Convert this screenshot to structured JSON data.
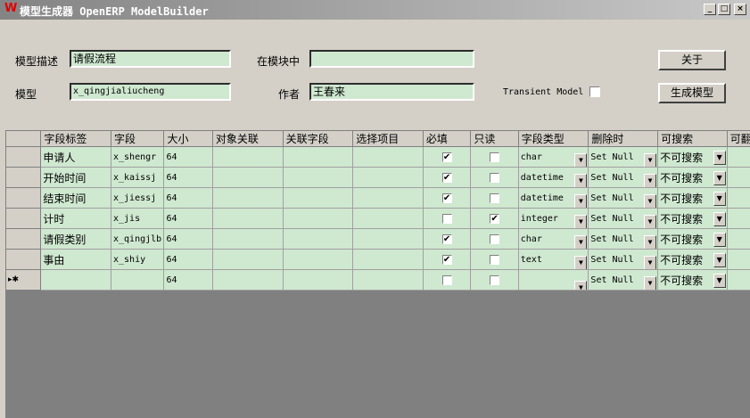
{
  "window": {
    "title": "模型生成器 OpenERP ModelBuilder",
    "minimize": "_",
    "maximize": "□",
    "close": "×"
  },
  "form": {
    "desc_label": "模型描述",
    "desc_value": "请假流程",
    "module_label": "在模块中",
    "module_value": "",
    "model_label": "模型",
    "model_value": "x_qingjialiucheng",
    "author_label": "作者",
    "author_value": "王春来",
    "transient_label": "Transient Model",
    "transient_checked": false,
    "about_button": "关于",
    "generate_button": "生成模型"
  },
  "grid": {
    "columns": [
      "字段标签",
      "字段",
      "大小",
      "对象关联",
      "关联字段",
      "选择项目",
      "必填",
      "只读",
      "字段类型",
      "删除时",
      "可搜索",
      "可翻"
    ],
    "new_row_marker": "▸✱",
    "rows": [
      {
        "label": "申请人",
        "field": "x_shengr",
        "size": "64",
        "relation": "",
        "rel_field": "",
        "selection": "",
        "required": true,
        "readonly": false,
        "type": "char",
        "ondelete": "Set Null",
        "searchable": "不可搜索"
      },
      {
        "label": "开始时间",
        "field": "x_kaissj",
        "size": "64",
        "relation": "",
        "rel_field": "",
        "selection": "",
        "required": true,
        "readonly": false,
        "type": "datetime",
        "ondelete": "Set Null",
        "searchable": "不可搜索"
      },
      {
        "label": "结束时间",
        "field": "x_jiessj",
        "size": "64",
        "relation": "",
        "rel_field": "",
        "selection": "",
        "required": true,
        "readonly": false,
        "type": "datetime",
        "ondelete": "Set Null",
        "searchable": "不可搜索"
      },
      {
        "label": "计时",
        "field": "x_jis",
        "size": "64",
        "relation": "",
        "rel_field": "",
        "selection": "",
        "required": false,
        "readonly": true,
        "type": "integer",
        "ondelete": "Set Null",
        "searchable": "不可搜索"
      },
      {
        "label": "请假类别",
        "field": "x_qingjlb",
        "size": "64",
        "relation": "",
        "rel_field": "",
        "selection": "",
        "required": true,
        "readonly": false,
        "type": "char",
        "ondelete": "Set Null",
        "searchable": "不可搜索"
      },
      {
        "label": "事由",
        "field": "x_shiy",
        "size": "64",
        "relation": "",
        "rel_field": "",
        "selection": "",
        "required": true,
        "readonly": false,
        "type": "text",
        "ondelete": "Set Null",
        "searchable": "不可搜索"
      },
      {
        "label": "",
        "field": "",
        "size": "64",
        "relation": "",
        "rel_field": "",
        "selection": "",
        "required": false,
        "readonly": false,
        "type": "",
        "ondelete": "Set Null",
        "searchable": "不可搜索",
        "is_new": true
      }
    ]
  }
}
